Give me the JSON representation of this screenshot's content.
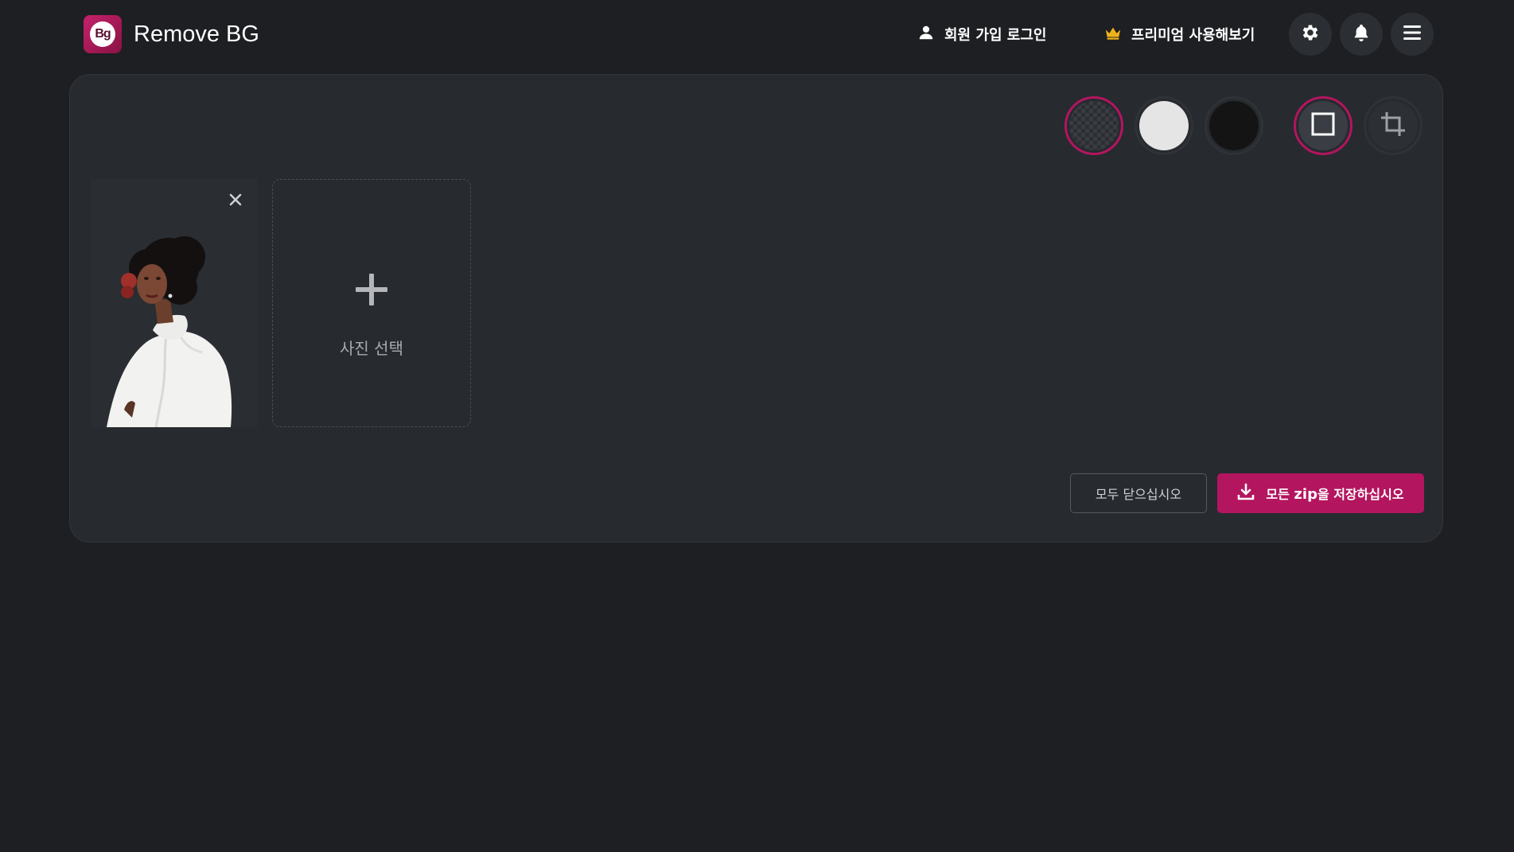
{
  "header": {
    "logo_text": "Bg",
    "app_title": "Remove BG",
    "login_label": "회원 가입 로그인",
    "premium_label": "프리미엄 사용해보기",
    "icons": {
      "user": "user-icon",
      "crown": "crown-icon",
      "settings": "gear-icon",
      "notifications": "bell-icon",
      "menu": "hamburger-menu-icon"
    }
  },
  "toolbar": {
    "background_options": [
      {
        "id": "transparent",
        "selected": true
      },
      {
        "id": "white",
        "color": "#e5e5e5",
        "selected": false
      },
      {
        "id": "black",
        "color": "#141414",
        "selected": false
      }
    ],
    "view_options": [
      {
        "id": "original",
        "icon": "square-icon",
        "selected": true
      },
      {
        "id": "crop",
        "icon": "crop-icon",
        "selected": false
      }
    ]
  },
  "images": [
    {
      "icon": "close-icon"
    }
  ],
  "add_photo": {
    "label": "사진 선택",
    "icon": "plus-icon"
  },
  "actions": {
    "close_all_label": "모두 닫으십시오",
    "save_zip_prefix": "모든 ",
    "save_zip_bold": "zip",
    "save_zip_suffix": "을 저장하십시오"
  },
  "colors": {
    "accent": "#b3155f",
    "background": "#1d1f22",
    "panel": "#272a2f",
    "crown": "#f0b21a"
  }
}
